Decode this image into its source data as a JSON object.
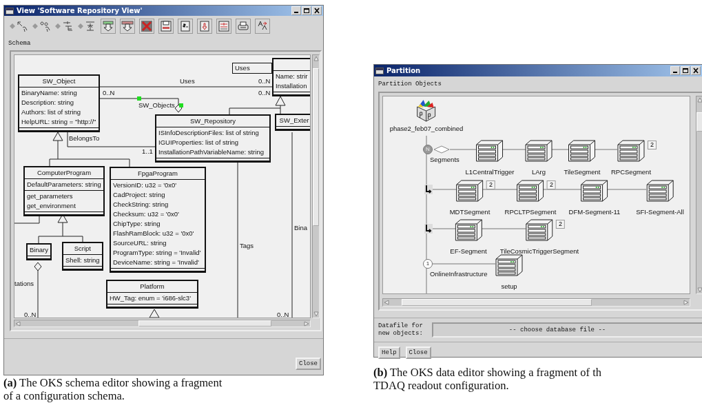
{
  "schema_window": {
    "title": "View 'Software Repository View'",
    "section_label": "Schema",
    "classes": [
      {
        "name": "SW_Object",
        "attributes": [
          "BinaryName: string",
          "Description: string",
          "Authors: list of string",
          "HelpURL: string = \"http://\""
        ]
      },
      {
        "attributes": [
          "Name: strir",
          "Installation"
        ]
      },
      {
        "name": "SW_Repository",
        "attributes": [
          "ISInfoDescriptionFiles: list of string",
          "IGUIProperties: list of string",
          "InstallationPathVariableName: string"
        ]
      },
      {
        "name": "SW_Exter"
      },
      {
        "name": "ComputerProgram",
        "attributes": [
          "DefaultParameters: string"
        ],
        "methods": [
          "get_parameters",
          "get_environment"
        ]
      },
      {
        "name": "FpgaProgram",
        "attributes": [
          "VersionID: u32 = '0x0'",
          "CadProject: string",
          "CheckString: string",
          "Checksum: u32 = '0x0'",
          "ChipType: string",
          "FlashRamBlock: u32 = '0x0'",
          "SourceURL: string",
          "ProgramType: string = 'Invalid'",
          "DeviceName: string = 'Invalid'"
        ]
      },
      {
        "name": "Binary"
      },
      {
        "name": "Script",
        "attributes": [
          "Shell: string"
        ]
      },
      {
        "name": "Platform",
        "attributes": [
          "HW_Tag: enum = 'i686-slc3'"
        ]
      }
    ],
    "labels": [
      {
        "kind": "boxed",
        "text": "Uses"
      },
      {
        "kind": "role",
        "text": "Uses"
      },
      {
        "kind": "multiplicity",
        "text": "0..N"
      },
      {
        "kind": "multiplicity",
        "text": "0..N"
      },
      {
        "kind": "multiplicity",
        "text": "0..N"
      },
      {
        "kind": "role",
        "text": "SW_Objects"
      },
      {
        "kind": "role",
        "text": "BelongsTo"
      },
      {
        "kind": "multiplicity",
        "text": "1..1"
      },
      {
        "kind": "role",
        "text": "tations"
      },
      {
        "kind": "role",
        "text": "Tags"
      },
      {
        "kind": "role",
        "text": "Bina"
      },
      {
        "kind": "multiplicity",
        "text": "0..N"
      },
      {
        "kind": "multiplicity",
        "text": "0..N"
      }
    ],
    "close_button": "Close"
  },
  "schema_caption": [
    "**(a)** The OKS schema editor showing a fragment",
    "of a configuration schema."
  ],
  "partition_window": {
    "title": "Partition",
    "section_label": "Partition Objects",
    "root": {
      "name": "phase2_feb07_combined"
    },
    "relations": [
      {
        "kind": "many",
        "marker": "N",
        "label": "Segments",
        "objects": [
          {
            "name": "L1CentralTrigger"
          },
          {
            "name": "LArg"
          },
          {
            "name": "TileSegment"
          },
          {
            "name": "RPCSegment",
            "count": "2"
          }
        ]
      },
      {
        "kind": "continuation",
        "objects": [
          {
            "name": "MDTSegment",
            "count": "2"
          },
          {
            "name": "RPCLTPSegment",
            "count": "2"
          },
          {
            "name": "DFM-Segment-11"
          },
          {
            "name": "SFI-Segment-All"
          }
        ]
      },
      {
        "kind": "continuation",
        "objects": [
          {
            "name": "EF-Segment"
          },
          {
            "name": "TileCosmicTriggerSegment",
            "count": "2"
          }
        ]
      },
      {
        "kind": "single",
        "marker": "1",
        "label": "OnlineInfrastructure",
        "objects": [
          {
            "name": "setup"
          }
        ]
      }
    ],
    "datafile_label": "Datafile for new objects:",
    "datafile_field": {
      "value": "-- choose database file --"
    },
    "buttons": [
      "Help",
      "Close"
    ]
  },
  "partition_caption": [
    "**(b)** The OKS data editor showing a fragment of th",
    "TDAQ readout configuration."
  ]
}
